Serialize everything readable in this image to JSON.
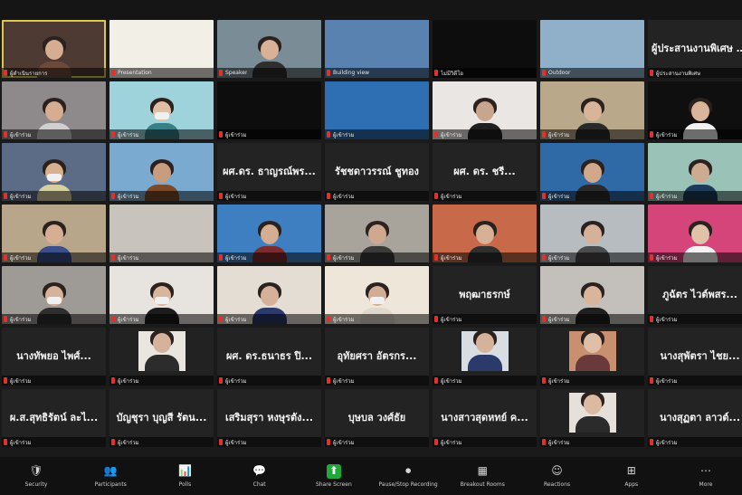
{
  "colors": {
    "background": "#1a1a1a",
    "tile": "#232323",
    "active_border": "#d8c94a",
    "mute_red": "#e5302a",
    "share_green": "#1fa83c"
  },
  "tiles": [
    {
      "kind": "video",
      "bg": "#4c3a33",
      "caption": "ผู้ดำเนินรายการ",
      "person": true,
      "skin": "#d6ad90",
      "shirt": "#6b4a3a",
      "active": true
    },
    {
      "kind": "video",
      "bg": "#f2efe7",
      "caption": "Presentation",
      "person": false
    },
    {
      "kind": "video",
      "bg": "#7a8c95",
      "caption": "Speaker",
      "person": true,
      "skin": "#d8b196",
      "shirt": "#2e2e2e"
    },
    {
      "kind": "video",
      "bg": "#5a82b0",
      "caption": "Building view",
      "person": false
    },
    {
      "kind": "black",
      "bg": "#0d0d0d",
      "caption": "ไม่มีวิดีโอ"
    },
    {
      "kind": "video",
      "bg": "#8fb0c8",
      "caption": "Outdoor",
      "person": false
    },
    {
      "kind": "name",
      "name": "ผู้ประสานงานพิเศษ จ...",
      "caption": "ผู้ประสานงานพิเศษ"
    },
    {
      "kind": "video",
      "bg": "#8e8a8c",
      "caption": "ผู้เข้าร่วม",
      "person": true,
      "skin": "#d6ad90",
      "shirt": "#cfcfcf"
    },
    {
      "kind": "video",
      "bg": "#9fd3db",
      "caption": "ผู้เข้าร่วม",
      "person": true,
      "skin": "#e0bfa5",
      "shirt": "#3a7f86",
      "mask": true
    },
    {
      "kind": "black",
      "bg": "#0d0d0d",
      "caption": "ผู้เข้าร่วม"
    },
    {
      "kind": "video",
      "bg": "#2d6fb2",
      "caption": "ผู้เข้าร่วม",
      "person": false
    },
    {
      "kind": "video",
      "bg": "#e9e6e4",
      "caption": "ผู้เข้าร่วม",
      "person": true,
      "skin": "#caa58d",
      "shirt": "#1f1f1f"
    },
    {
      "kind": "video",
      "bg": "#b9a98a",
      "caption": "ผู้เข้าร่วม",
      "person": true,
      "skin": "#d8b49a",
      "shirt": "#2a2a2a"
    },
    {
      "kind": "video",
      "bg": "#0f0f0f",
      "caption": "ผู้เข้าร่วม",
      "person": true,
      "skin": "#d9b59a",
      "shirt": "#f1f1f1"
    },
    {
      "kind": "video",
      "bg": "#5d6c86",
      "caption": "ผู้เข้าร่วม",
      "person": true,
      "skin": "#d7b08f",
      "shirt": "#d8cfa0",
      "mask": true
    },
    {
      "kind": "video",
      "bg": "#7aaad0",
      "caption": "ผู้เข้าร่วม",
      "person": true,
      "skin": "#c89c7f",
      "shirt": "#7a4a2a"
    },
    {
      "kind": "name",
      "name": "ผศ.ดร. ธาญรณ์พร...",
      "caption": "ผู้เข้าร่วม"
    },
    {
      "kind": "name",
      "name": "รัชชดาวรรณ์ ชูทอง",
      "caption": "ผู้เข้าร่วม"
    },
    {
      "kind": "name",
      "name": "ผศ. ดร. ชรี...",
      "caption": "ผู้เข้าร่วม"
    },
    {
      "kind": "video",
      "bg": "#2f69a6",
      "caption": "ผู้เข้าร่วม",
      "person": true,
      "skin": "#d2a88a",
      "shirt": "#2a2a2a"
    },
    {
      "kind": "video",
      "bg": "#9ac2b7",
      "caption": "ผู้เข้าร่วม",
      "person": true,
      "skin": "#ccab91",
      "shirt": "#1e3a5a"
    },
    {
      "kind": "video",
      "bg": "#b7a68a",
      "caption": "ผู้เข้าร่วม",
      "person": true,
      "skin": "#d5ae94",
      "shirt": "#3b4f8a"
    },
    {
      "kind": "video",
      "bg": "#c9c3bd",
      "caption": "ผู้เข้าร่วม",
      "person": false
    },
    {
      "kind": "video",
      "bg": "#3e7fc1",
      "caption": "ผู้เข้าร่วม",
      "person": true,
      "skin": "#d4ad92",
      "shirt": "#7b2c2c"
    },
    {
      "kind": "video",
      "bg": "#a9a49b",
      "caption": "ผู้เข้าร่วม",
      "person": true,
      "skin": "#cfa98f",
      "shirt": "#3a3a3a"
    },
    {
      "kind": "video",
      "bg": "#c86a4a",
      "caption": "ผู้เข้าร่วม",
      "person": true,
      "skin": "#d7b096",
      "shirt": "#2f2f2f"
    },
    {
      "kind": "video",
      "bg": "#b6bcc0",
      "caption": "ผู้เข้าร่วม",
      "person": true,
      "skin": "#d6b199",
      "shirt": "#4b4b4b"
    },
    {
      "kind": "video",
      "bg": "#d5457a",
      "caption": "ผู้เข้าร่วม",
      "person": true,
      "skin": "#e0c1aa",
      "shirt": "#f3f3f3"
    },
    {
      "kind": "video",
      "bg": "#9e9a95",
      "caption": "ผู้เข้าร่วม",
      "person": true,
      "skin": "#d6b29a",
      "shirt": "#2f2f2f",
      "mask": true
    },
    {
      "kind": "video",
      "bg": "#e7e3de",
      "caption": "ผู้เข้าร่วม",
      "person": true,
      "skin": "#d8b59c",
      "shirt": "#1c1c1c",
      "mask": true
    },
    {
      "kind": "video",
      "bg": "#e4ddd3",
      "caption": "ผู้เข้าร่วม",
      "person": true,
      "skin": "#d6b197",
      "shirt": "#2a3a6a"
    },
    {
      "kind": "video",
      "bg": "#efe6da",
      "caption": "ผู้เข้าร่วม",
      "person": true,
      "skin": "#d3ad93",
      "shirt": "#e0d8cd",
      "mask": true
    },
    {
      "kind": "name",
      "name": "พฤฒาธรกษ์",
      "caption": "ผู้เข้าร่วม"
    },
    {
      "kind": "video",
      "bg": "#c3c0bb",
      "caption": "ผู้เข้าร่วม",
      "person": true,
      "skin": "#d9b59c",
      "shirt": "#1f1f1f"
    },
    {
      "kind": "name",
      "name": "ภูฉัตร ไวต์พสร...",
      "caption": "ผู้เข้าร่วม"
    },
    {
      "kind": "name",
      "name": "นางทัพยอ ไพศ์...",
      "caption": "ผู้เข้าร่วม"
    },
    {
      "kind": "pic",
      "bg": "#222",
      "pbg": "#e9e6e0",
      "caption": "ผู้เข้าร่วม",
      "skin": "#d7b29a",
      "shirt": "#2c2c2c"
    },
    {
      "kind": "name",
      "name": "ผศ. ดร.ธนาธร ปิ...",
      "caption": "ผู้เข้าร่วม"
    },
    {
      "kind": "name",
      "name": "อุทัยศรา อัตรกร...",
      "caption": "ผู้เข้าร่วม"
    },
    {
      "kind": "pic",
      "bg": "#222",
      "pbg": "#d8dde2",
      "caption": "ผู้เข้าร่วม",
      "skin": "#d6b29a",
      "shirt": "#2a3a6a"
    },
    {
      "kind": "pic",
      "bg": "#222",
      "pbg": "#c99070",
      "caption": "ผู้เข้าร่วม",
      "skin": "#e0bfa8",
      "shirt": "#6a3a3a"
    },
    {
      "kind": "name",
      "name": "นางสุพัตรา ไชย...",
      "caption": "ผู้เข้าร่วม"
    },
    {
      "kind": "name",
      "name": "ผ.ส.สุทธิรัตน์ ละไ...",
      "caption": "ผู้เข้าร่วม"
    },
    {
      "kind": "name",
      "name": "บัญชุรา บุญสี รัตน...",
      "caption": "ผู้เข้าร่วม"
    },
    {
      "kind": "name",
      "name": "เสริมสุรา หงษุรตัง...",
      "caption": "ผู้เข้าร่วม"
    },
    {
      "kind": "name",
      "name": "บุษบล วงศ์ธัย",
      "caption": "ผู้เข้าร่วม"
    },
    {
      "kind": "name",
      "name": "นางสาวสุดหทย์ ค...",
      "caption": "ผู้เข้าร่วม"
    },
    {
      "kind": "pic",
      "bg": "#222",
      "pbg": "#e6e0da",
      "caption": "ผู้เข้าร่วม",
      "skin": "#dcbaa2",
      "shirt": "#2b2b2b"
    },
    {
      "kind": "name",
      "name": "นางสุฏตา ลาวต์...",
      "caption": "ผู้เข้าร่วม"
    }
  ],
  "toolbar": [
    {
      "icon": "🛡",
      "label": "Security",
      "name": "security"
    },
    {
      "icon": "👥",
      "label": "Participants",
      "name": "participants"
    },
    {
      "icon": "📊",
      "label": "Polls",
      "name": "polls"
    },
    {
      "icon": "💬",
      "label": "Chat",
      "name": "chat"
    },
    {
      "icon": "⬆",
      "label": "Share Screen",
      "name": "share-screen",
      "green": true
    },
    {
      "icon": "⏺",
      "label": "Pause/Stop Recording",
      "name": "recording"
    },
    {
      "icon": "▦",
      "label": "Breakout Rooms",
      "name": "breakout-rooms"
    },
    {
      "icon": "☺",
      "label": "Reactions",
      "name": "reactions"
    },
    {
      "icon": "⊞",
      "label": "Apps",
      "name": "apps"
    },
    {
      "icon": "⋯",
      "label": "More",
      "name": "more"
    }
  ]
}
